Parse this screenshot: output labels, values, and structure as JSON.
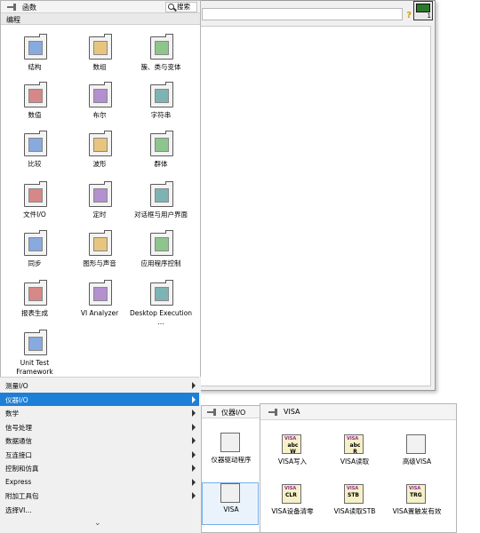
{
  "background_window": {
    "help_icon": "?",
    "vi_icon_number": "1"
  },
  "palette": {
    "title": "函数",
    "search_label": "搜索",
    "section": "编程",
    "tiles": [
      {
        "label": "结构",
        "icon": "structures-icon"
      },
      {
        "label": "数组",
        "icon": "array-icon"
      },
      {
        "label": "簇、类与变体",
        "icon": "cluster-class-variant-icon"
      },
      {
        "label": "数值",
        "icon": "numeric-icon"
      },
      {
        "label": "布尔",
        "icon": "boolean-icon"
      },
      {
        "label": "字符串",
        "icon": "string-icon"
      },
      {
        "label": "比较",
        "icon": "comparison-icon"
      },
      {
        "label": "波形",
        "icon": "waveform-icon"
      },
      {
        "label": "群体",
        "icon": "collections-icon"
      },
      {
        "label": "文件I/O",
        "icon": "file-io-icon"
      },
      {
        "label": "定时",
        "icon": "timing-icon"
      },
      {
        "label": "对话框与用户界面",
        "icon": "dialog-ui-icon"
      },
      {
        "label": "同步",
        "icon": "synchronization-icon"
      },
      {
        "label": "图形与声音",
        "icon": "graphics-sound-icon"
      },
      {
        "label": "应用程序控制",
        "icon": "application-control-icon"
      },
      {
        "label": "报表生成",
        "icon": "report-generation-icon"
      },
      {
        "label": "VI Analyzer",
        "icon": "vi-analyzer-icon"
      },
      {
        "label": "Desktop Execution ...",
        "icon": "desktop-execution-icon"
      },
      {
        "label": "Unit Test Framework",
        "icon": "unit-test-framework-icon"
      }
    ]
  },
  "menu": {
    "items": [
      {
        "label": "测量I/O",
        "submenu": true,
        "selected": false
      },
      {
        "label": "仪器I/O",
        "submenu": true,
        "selected": true
      },
      {
        "label": "数学",
        "submenu": true,
        "selected": false
      },
      {
        "label": "信号处理",
        "submenu": true,
        "selected": false
      },
      {
        "label": "数据通信",
        "submenu": true,
        "selected": false
      },
      {
        "label": "互连接口",
        "submenu": true,
        "selected": false
      },
      {
        "label": "控制和仿真",
        "submenu": true,
        "selected": false
      },
      {
        "label": "Express",
        "submenu": true,
        "selected": false
      },
      {
        "label": "附加工具包",
        "submenu": true,
        "selected": false
      },
      {
        "label": "选择VI...",
        "submenu": false,
        "selected": false
      }
    ],
    "more": "⌄"
  },
  "instrument_io": {
    "title": "仪器I/O",
    "items": [
      {
        "label": "仪器驱动程序",
        "icon": "instrument-drivers-icon"
      },
      {
        "label": "VISA",
        "icon": "visa-icon"
      }
    ]
  },
  "visa": {
    "title": "VISA",
    "items": [
      {
        "label": "VISA写入",
        "icon_top": "VISA",
        "icon_mid": "abc W",
        "icon": "visa-write-icon"
      },
      {
        "label": "VISA读取",
        "icon_top": "VISA",
        "icon_mid": "abc R",
        "icon": "visa-read-icon"
      },
      {
        "label": "高级VISA",
        "icon_top": "",
        "icon_mid": "",
        "icon": "advanced-visa-icon"
      },
      {
        "label": "VISA设备清零",
        "icon_top": "VISA",
        "icon_mid": "CLR",
        "icon": "visa-clear-icon"
      },
      {
        "label": "VISA读取STB",
        "icon_top": "VISA",
        "icon_mid": "STB",
        "icon": "visa-read-stb-icon"
      },
      {
        "label": "VISA置触发有效",
        "icon_top": "VISA",
        "icon_mid": "TRG",
        "icon": "visa-assert-trigger-icon"
      }
    ]
  }
}
